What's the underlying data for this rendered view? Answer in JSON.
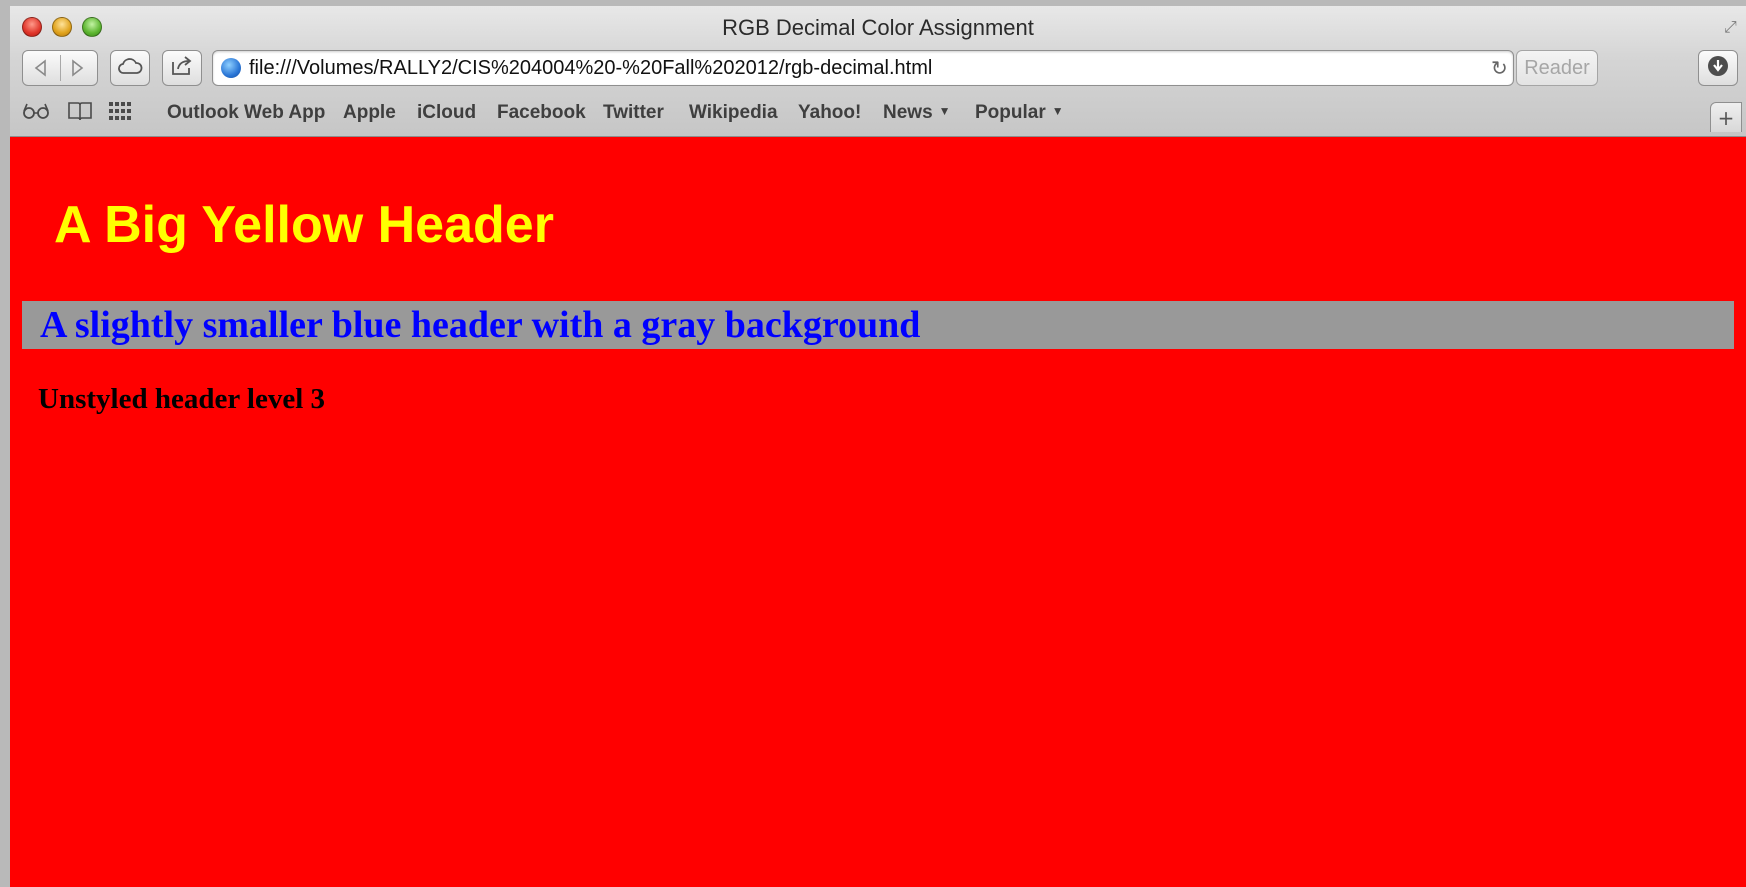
{
  "window": {
    "title": "RGB Decimal Color Assignment"
  },
  "toolbar": {
    "url": "file:///Volumes/RALLY2/CIS%204004%20-%20Fall%202012/rgb-decimal.html",
    "reader_label": "Reader"
  },
  "bookmarks": {
    "items": [
      {
        "label": "Outlook Web App"
      },
      {
        "label": "Apple"
      },
      {
        "label": "iCloud"
      },
      {
        "label": "Facebook"
      },
      {
        "label": "Twitter"
      },
      {
        "label": "Wikipedia"
      },
      {
        "label": "Yahoo!"
      },
      {
        "label": "News"
      },
      {
        "label": "Popular"
      }
    ]
  },
  "page": {
    "h1": "A Big Yellow Header",
    "h2": "A slightly smaller blue header with a gray background",
    "h3": "Unstyled header level 3",
    "colors": {
      "background": "#ff0000",
      "h1_text": "#ffff00",
      "h2_text": "#0000ff",
      "h2_background": "#999999",
      "h3_text": "#000000"
    }
  }
}
